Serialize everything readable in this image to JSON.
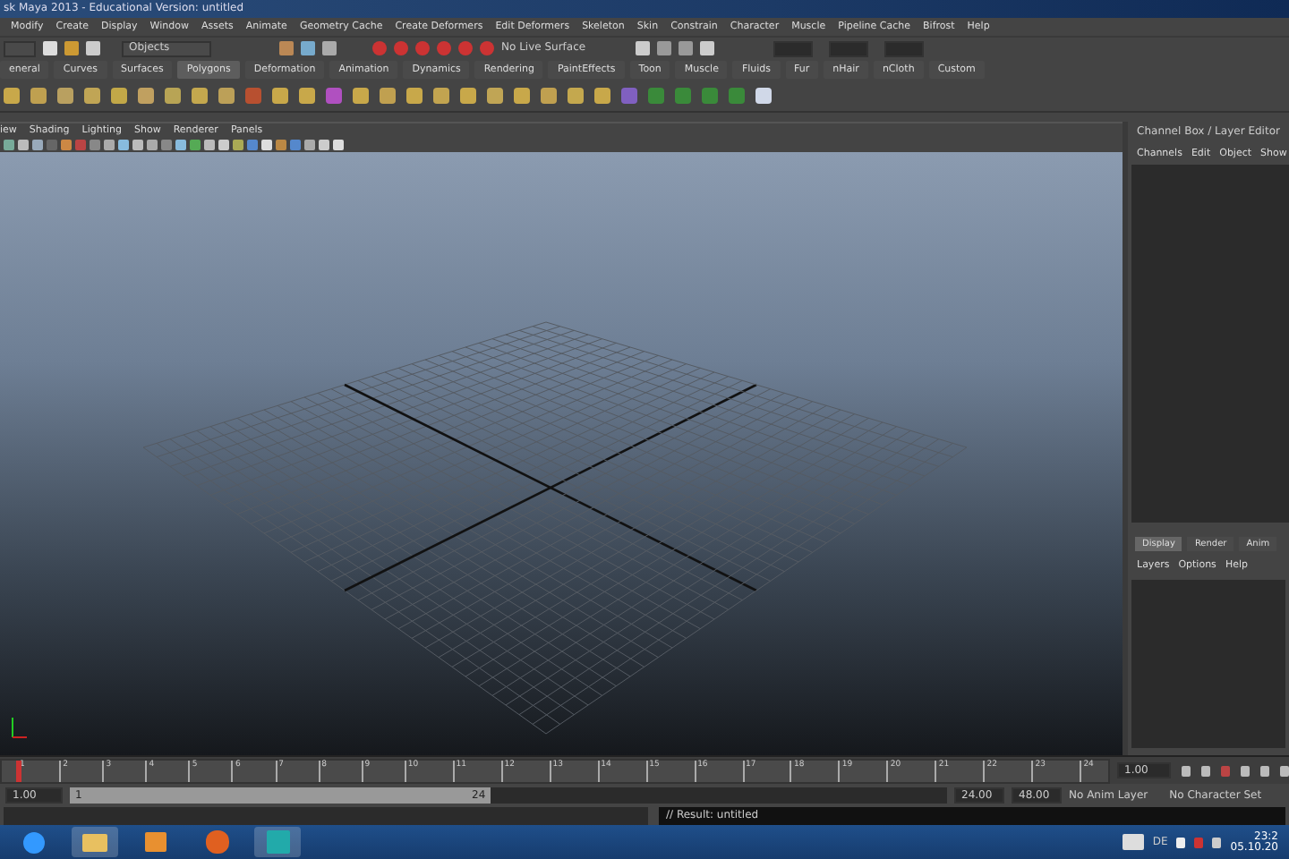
{
  "window": {
    "title": "sk Maya 2013 - Educational Version: untitled"
  },
  "menu": [
    "Modify",
    "Create",
    "Display",
    "Window",
    "Assets",
    "Animate",
    "Geometry Cache",
    "Create Deformers",
    "Edit Deformers",
    "Skeleton",
    "Skin",
    "Constrain",
    "Character",
    "Muscle",
    "Pipeline Cache",
    "Bifrost",
    "Help"
  ],
  "status_line": {
    "selection_mode": "Objects",
    "live_surface": "No Live Surface"
  },
  "shelf_tabs": [
    {
      "label": "eneral",
      "selected": false
    },
    {
      "label": "Curves",
      "selected": false
    },
    {
      "label": "Surfaces",
      "selected": false
    },
    {
      "label": "Polygons",
      "selected": true
    },
    {
      "label": "Deformation",
      "selected": false
    },
    {
      "label": "Animation",
      "selected": false
    },
    {
      "label": "Dynamics",
      "selected": false
    },
    {
      "label": "Rendering",
      "selected": false
    },
    {
      "label": "PaintEffects",
      "selected": false
    },
    {
      "label": "Toon",
      "selected": false
    },
    {
      "label": "Muscle",
      "selected": false
    },
    {
      "label": "Fluids",
      "selected": false
    },
    {
      "label": "Fur",
      "selected": false
    },
    {
      "label": "nHair",
      "selected": false
    },
    {
      "label": "nCloth",
      "selected": false
    },
    {
      "label": "Custom",
      "selected": false
    }
  ],
  "panel_menu": [
    "iew",
    "Shading",
    "Lighting",
    "Show",
    "Renderer",
    "Panels"
  ],
  "channel_box": {
    "title": "Channel Box / Layer Editor",
    "menu": [
      "Channels",
      "Edit",
      "Object",
      "Show"
    ]
  },
  "layer_editor": {
    "tabs": [
      {
        "label": "Display",
        "selected": true
      },
      {
        "label": "Render",
        "selected": false
      },
      {
        "label": "Anim",
        "selected": false
      }
    ],
    "menu": [
      "Layers",
      "Options",
      "Help"
    ]
  },
  "timeline": {
    "ticks": [
      "1",
      "2",
      "3",
      "4",
      "5",
      "6",
      "7",
      "8",
      "9",
      "10",
      "11",
      "12",
      "13",
      "14",
      "15",
      "16",
      "17",
      "18",
      "19",
      "20",
      "21",
      "22",
      "23",
      "24"
    ],
    "current_frame": "1.00",
    "level": 0
  },
  "range": {
    "start": "1.00",
    "range_start": "1",
    "range_end": "24",
    "level": 0.48,
    "end": "24.00",
    "max": "48.00",
    "anim_layer": "No Anim Layer",
    "character_set": "No Character Set"
  },
  "command_line": {
    "result": "// Result: untitled"
  },
  "taskbar": {
    "language": "DE",
    "time": "23:2",
    "date": "05.10.20"
  }
}
